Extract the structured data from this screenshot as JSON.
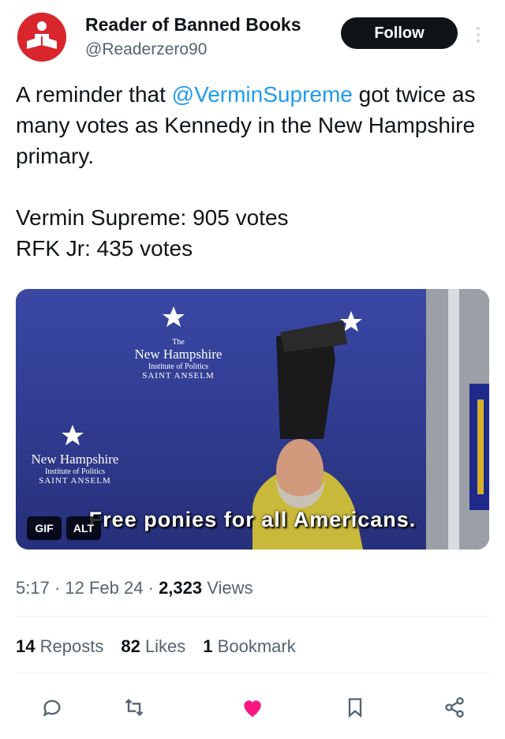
{
  "author": {
    "name": "Reader of Banned Books",
    "handle": "@Readerzero90",
    "follow_label": "Follow"
  },
  "tweet": {
    "text_part1": "A reminder that ",
    "mention": "@VerminSupreme",
    "text_part2": " got twice as many votes as Kennedy in the New Hampshire primary.",
    "line_votes1": "Vermin Supreme: 905 votes",
    "line_votes2": "RFK Jr: 435 votes"
  },
  "media": {
    "caption": "Free ponies for all Americans.",
    "gif_label": "GIF",
    "alt_label": "ALT",
    "backdrop": {
      "institute_small": "The",
      "institute_title": "New Hampshire",
      "institute_sub": "Institute of Politics",
      "institute_college": "SAINT ANSELM"
    }
  },
  "meta": {
    "time": "5:17",
    "date": "12 Feb 24",
    "views_count": "2,323",
    "views_label": "Views",
    "separator": "·"
  },
  "stats": {
    "reposts_count": "14",
    "reposts_label": "Reposts",
    "likes_count": "82",
    "likes_label": "Likes",
    "bookmarks_count": "1",
    "bookmarks_label": "Bookmark"
  },
  "colors": {
    "accent": "#1d9bf0",
    "like": "#f91880",
    "muted": "#536471",
    "avatar_red": "#d8262c"
  }
}
